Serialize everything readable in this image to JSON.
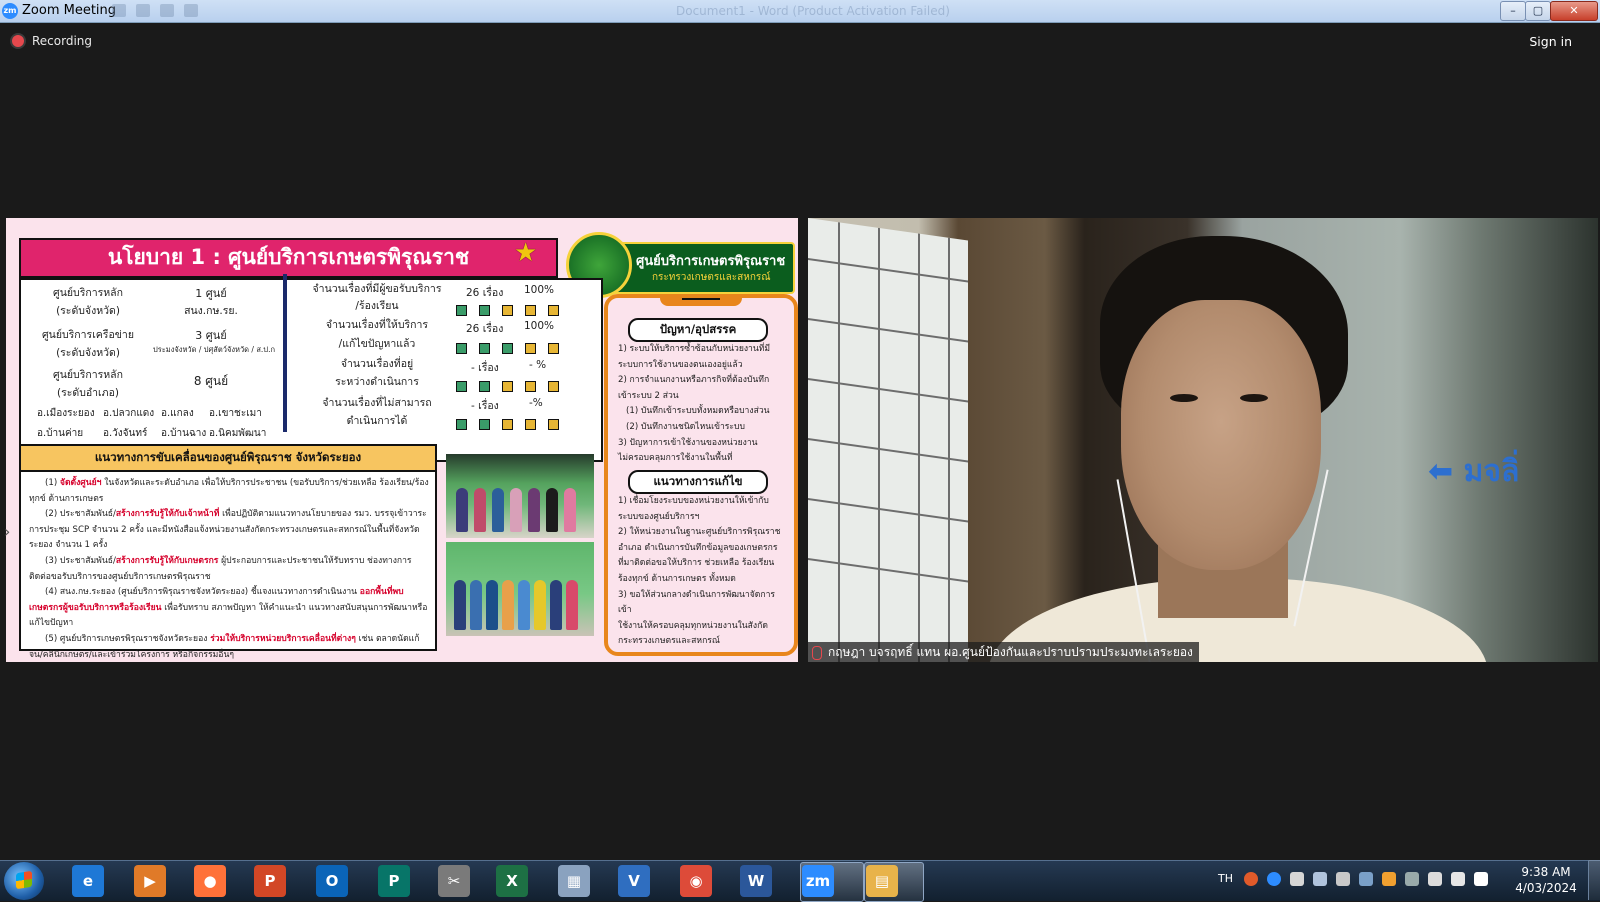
{
  "window": {
    "app_icon": "zm",
    "title": "Zoom Meeting",
    "ghost_title": "Document1 - Word (Product Activation Failed)"
  },
  "meeting": {
    "recording_label": "Recording",
    "sign_in_label": "Sign in"
  },
  "slide": {
    "title": "นโยบาย 1 : ศูนย์บริการเกษตรพิรุณราช",
    "brand_line1": "ศูนย์บริการเกษตรพิรุณราช",
    "brand_line2": "กระทรวงเกษตรและสหกรณ์",
    "centers": [
      {
        "label": "ศูนย์บริการหลัก",
        "sub": "(ระดับจังหวัด)",
        "value": "1 ศูนย์",
        "value_sub": "สนง.กษ.รย."
      },
      {
        "label": "ศูนย์บริการเครือข่าย",
        "sub": "(ระดับจังหวัด)",
        "value": "3 ศูนย์",
        "value_sub": "ประมงจังหวัด / ปศุสัตว์จังหวัด / ส.ป.ก"
      },
      {
        "label": "ศูนย์บริการหลัก",
        "sub": "(ระดับอำเภอ)",
        "value": "8 ศูนย์",
        "value_sub": ""
      }
    ],
    "districts_row1": [
      "อ.เมืองระยอง",
      "อ.ปลวกแดง",
      "อ.แกลง",
      "อ.เขาชะเมา"
    ],
    "districts_row2": [
      "อ.บ้านค่าย",
      "อ.วังจันทร์",
      "อ.บ้านฉาง",
      "อ.นิคมพัฒนา"
    ],
    "stats": [
      {
        "line1": "จำนวนเรื่องที่มีผู้ขอรับบริการ",
        "line2": "/ร้องเรียน",
        "count": "26 เรื่อง",
        "percent": "100%"
      },
      {
        "line1": "จำนวนเรื่องที่ให้บริการ",
        "line2": "/แก้ไขปัญหาแล้ว",
        "count": "26 เรื่อง",
        "percent": "100%"
      },
      {
        "line1": "จำนวนเรื่องที่อยู่",
        "line2": "ระหว่างดำเนินการ",
        "count": "- เรื่อง",
        "percent": "- %"
      },
      {
        "line1": "จำนวนเรื่องที่ไม่สามารถ",
        "line2": "ดำเนินการได้",
        "count": "- เรื่อง",
        "percent": "-%"
      }
    ],
    "problems_title": "ปัญหา/อุปสรรค",
    "problems": [
      "1) ระบบให้บริการซ้ำซ้อนกับหน่วยงานที่มี",
      "ระบบการใช้งานของตนเองอยู่แล้ว",
      "2) การจำแนกงานหรือภารกิจที่ต้องบันทึก",
      "เข้าระบบ 2 ส่วน",
      "(1) บันทึกเข้าระบบทั้งหมดหรือบางส่วน",
      "(2) บันทึกงานชนิดไหนเข้าระบบ",
      "3) ปัญหาการเข้าใช้งานของหน่วยงาน",
      "ไม่ครอบคลุมการใช้งานในพื้นที่"
    ],
    "solutions_title": "แนวทางการแก้ไข",
    "solutions": [
      "1) เชื่อมโยงระบบของหน่วยงานให้เข้ากับ",
      "ระบบของศูนย์บริการฯ",
      "2) ให้หน่วยงานในฐานะศูนย์บริการพิรุณราช",
      "อำเภอ ดำเนินการบันทึกข้อมูลของเกษตรกร",
      "ที่มาติดต่อขอให้บริการ ช่วยเหลือ ร้องเรียน",
      "ร้องทุกข์ ด้านการเกษตร ทั้งหมด",
      "3) ขอให้ส่วนกลางดำเนินการพัฒนาจัดการเข้า",
      "ใช้งานให้ครอบคลุมทุกหน่วยงานในสังกัด",
      "กระทรวงเกษตรและสหกรณ์"
    ],
    "drive_title": "แนวทางการขับเคลื่อนของศูนย์พิรุณราช จังหวัดระยอง",
    "drive_items": [
      {
        "pre": "(1) ",
        "red": "จัดตั้งศูนย์ฯ",
        "post": " ในจังหวัดและระดับอำเภอ เพื่อให้บริการประชาชน (ขอรับบริการ/ช่วยเหลือ ร้องเรียน/ร้องทุกข์ ด้านการเกษตร"
      },
      {
        "pre": "(2) ประชาสัมพันธ์/",
        "red": "สร้างการรับรู้ให้กับเจ้าหน้าที่",
        "post": " เพื่อปฏิบัติตามแนวทางนโยบายของ รมว. บรรจุเข้าวาระการประชุม SCP จำนวน 2 ครั้ง และมีหนังสือแจ้งหน่วยงานสังกัดกระทรวงเกษตรและสหกรณ์ในพื้นที่จังหวัดระยอง จำนวน 1 ครั้ง"
      },
      {
        "pre": "(3) ประชาสัมพันธ์/",
        "red": "สร้างการรับรู้ให้กับเกษตรกร",
        "post": " ผู้ประกอบการและประชาชนให้รับทราบ ช่องทางการติดต่อขอรับบริการของศูนย์บริการเกษตรพิรุณราช"
      },
      {
        "pre": "(4) สนง.กษ.ระยอง (ศูนย์บริการพิรุณราชจังหวัดระยอง) ชี้แจงแนวทางการดำเนินงาน ",
        "red": "ออกพื้นที่พบเกษตรกรผู้ขอรับบริการหรือร้องเรียน",
        "post": " เพื่อรับทราบ สภาพปัญหา ให้คำแนะนำ แนวทางสนับสนุนการพัฒนาหรือแก้ไขปัญหา"
      },
      {
        "pre": "(5) ศูนย์บริการเกษตรพิรุณราชจังหวัดระยอง ",
        "red": "ร่วมให้บริการหน่วยบริการเคลื่อนที่ต่างๆ",
        "post": " เช่น ตลาดนัดแก้จน/คลินิกเกษตร/และเข้าร่วมโครงการ หรือกิจกรรมอื่นๆ"
      }
    ]
  },
  "video": {
    "participant_name": "กฤษฎา บจรฤทธิ์ แทน ผอ.ศูนย์ป้องกันและปราบปรามประมงทะเลระยอง",
    "sign_text": "มจลิ่"
  },
  "taskbar": {
    "apps": [
      {
        "name": "internet-explorer",
        "glyph": "e",
        "color": "#1e78d6"
      },
      {
        "name": "media-player",
        "glyph": "▶",
        "color": "#e07a28"
      },
      {
        "name": "firefox",
        "glyph": "●",
        "color": "#ff7139"
      },
      {
        "name": "powerpoint",
        "glyph": "P",
        "color": "#d24726"
      },
      {
        "name": "outlook",
        "glyph": "O",
        "color": "#0a64b8"
      },
      {
        "name": "publisher",
        "glyph": "P",
        "color": "#077568"
      },
      {
        "name": "snipping-tool",
        "glyph": "✂",
        "color": "#7a7a7a"
      },
      {
        "name": "excel",
        "glyph": "X",
        "color": "#1d7044"
      },
      {
        "name": "calculator",
        "glyph": "▦",
        "color": "#8aa2bf"
      },
      {
        "name": "visio",
        "glyph": "V",
        "color": "#2f6ec0"
      },
      {
        "name": "chrome",
        "glyph": "◉",
        "color": "#dd4b39"
      },
      {
        "name": "word",
        "glyph": "W",
        "color": "#2b579a"
      },
      {
        "name": "zoom",
        "glyph": "zm",
        "color": "#2d8cff"
      },
      {
        "name": "file-explorer",
        "glyph": "▤",
        "color": "#e8b34a"
      }
    ],
    "language": "TH",
    "time": "9:38 AM",
    "date": "4/03/2024"
  }
}
